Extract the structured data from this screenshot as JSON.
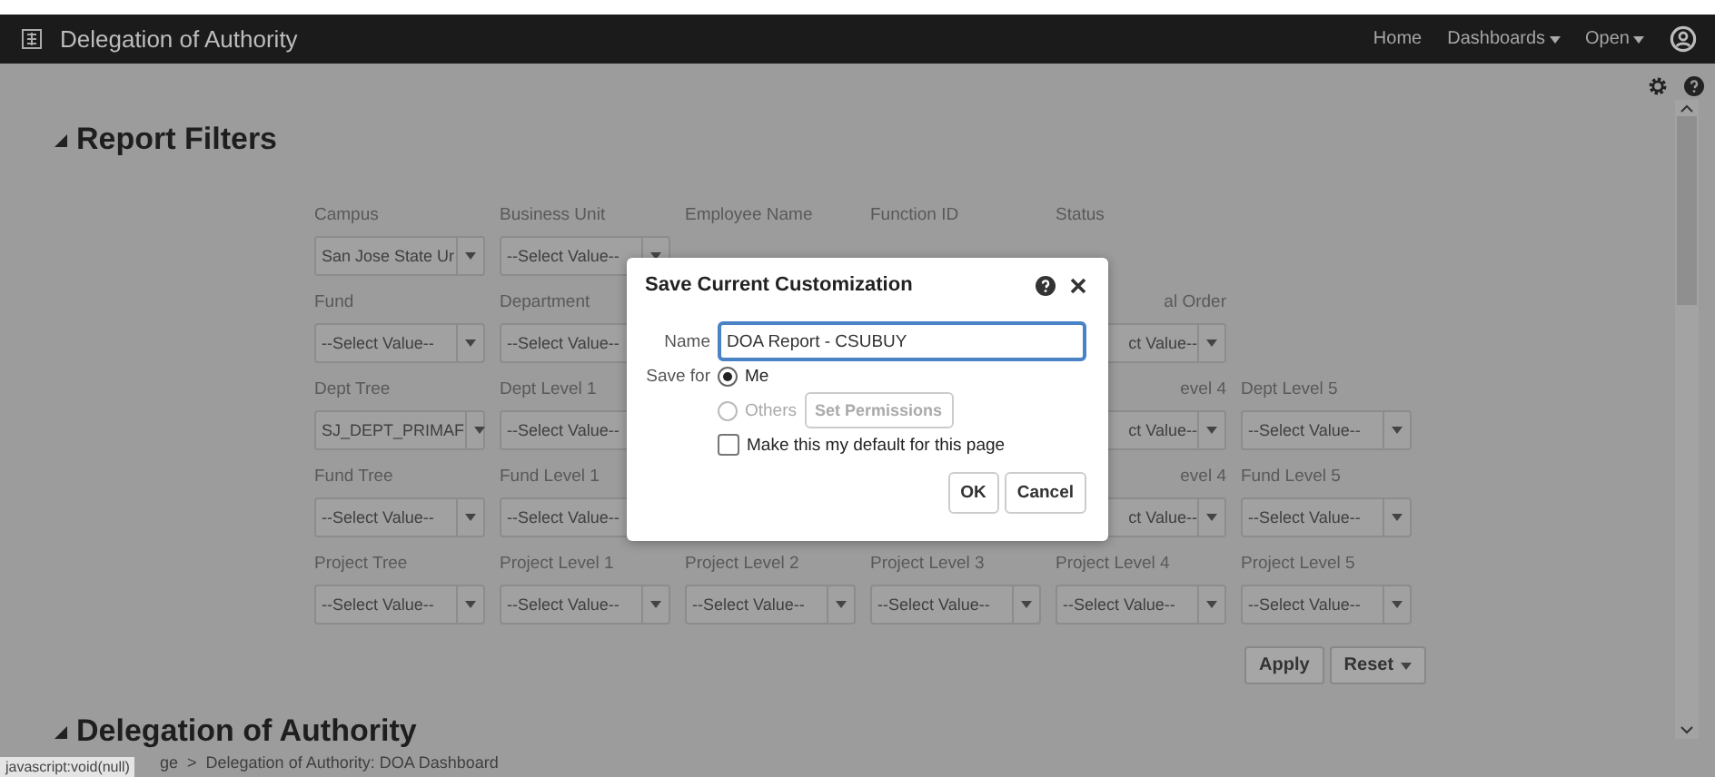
{
  "top_bar": {
    "title": "Delegation of Authority",
    "links": [
      {
        "label": "Home",
        "dropdown": false
      },
      {
        "label": "Dashboards",
        "dropdown": true
      },
      {
        "label": "Open",
        "dropdown": true
      }
    ]
  },
  "report_filters": {
    "title": "Report Filters",
    "expanded": true,
    "rows": [
      [
        {
          "kind": "select",
          "label": "Campus",
          "value": "San Jose State Ur"
        },
        {
          "kind": "select",
          "label": "Business Unit",
          "value": "--Select Value--"
        },
        {
          "kind": "label_only",
          "label": "Employee Name"
        },
        {
          "kind": "label_only",
          "label": "Function ID"
        },
        {
          "kind": "label_only",
          "label": "Status"
        }
      ],
      [
        {
          "kind": "select",
          "label": "Fund",
          "value": "--Select Value--"
        },
        {
          "kind": "select",
          "label": "Department",
          "value": "--Select Value--"
        },
        {
          "kind": "covered"
        },
        {
          "kind": "covered"
        },
        {
          "kind": "partial",
          "label": "al Order",
          "value": "ct Value--"
        }
      ],
      [
        {
          "kind": "select",
          "label": "Dept Tree",
          "value": "SJ_DEPT_PRIMAF"
        },
        {
          "kind": "select",
          "label": "Dept Level 1",
          "value": "--Select Value--"
        },
        {
          "kind": "covered"
        },
        {
          "kind": "covered"
        },
        {
          "kind": "partial",
          "label": "evel 4",
          "value": "ct Value--"
        },
        {
          "kind": "select",
          "label": "Dept Level 5",
          "value": "--Select Value--"
        }
      ],
      [
        {
          "kind": "select",
          "label": "Fund Tree",
          "value": "--Select Value--"
        },
        {
          "kind": "select",
          "label": "Fund Level 1",
          "value": "--Select Value--"
        },
        {
          "kind": "covered"
        },
        {
          "kind": "covered"
        },
        {
          "kind": "partial",
          "label": "evel 4",
          "value": "ct Value--"
        },
        {
          "kind": "select",
          "label": "Fund Level 5",
          "value": "--Select Value--"
        }
      ],
      [
        {
          "kind": "select",
          "label": "Project Tree",
          "value": "--Select Value--"
        },
        {
          "kind": "select",
          "label": "Project Level 1",
          "value": "--Select Value--"
        },
        {
          "kind": "select",
          "label": "Project Level 2",
          "value": "--Select Value--"
        },
        {
          "kind": "select",
          "label": "Project Level 3",
          "value": "--Select Value--"
        },
        {
          "kind": "select",
          "label": "Project Level 4",
          "value": "--Select Value--"
        },
        {
          "kind": "select",
          "label": "Project Level 5",
          "value": "--Select Value--"
        }
      ]
    ],
    "buttons": [
      {
        "label": "Apply",
        "dropdown": false
      },
      {
        "label": "Reset",
        "dropdown": true
      }
    ]
  },
  "section": {
    "title": "Delegation of Authority",
    "expanded": true
  },
  "breadcrumb": {
    "items": [
      "ge",
      "Delegation of Authority: DOA Dashboard"
    ],
    "separator": ">"
  },
  "status_tooltip": "javascript:void(null)",
  "dialog": {
    "title": "Save Current Customization",
    "name_label": "Name",
    "name_value": "DOA Report - CSUBUY",
    "save_for_label": "Save for",
    "options": [
      {
        "label": "Me",
        "selected": true,
        "disabled": false
      },
      {
        "label": "Others",
        "selected": false,
        "disabled": true
      }
    ],
    "permissions_button": {
      "label": "Set Permissions",
      "disabled": true
    },
    "default_checkbox": {
      "label": "Make this my default for this page",
      "checked": false
    },
    "buttons": [
      "OK",
      "Cancel"
    ]
  }
}
